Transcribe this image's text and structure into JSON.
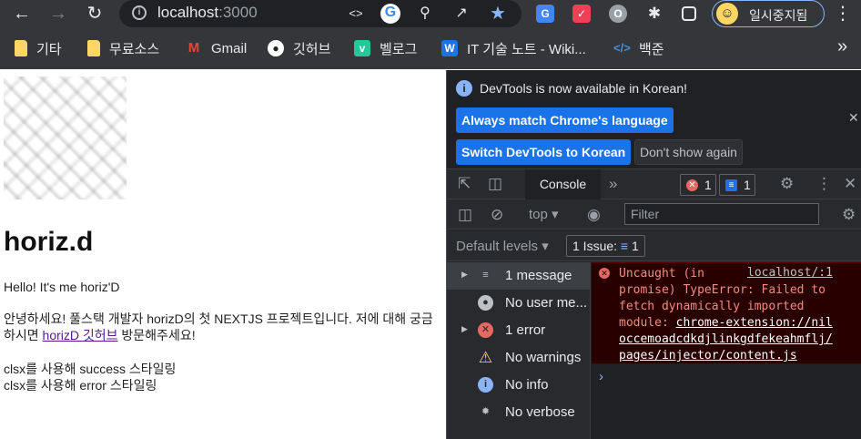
{
  "browser": {
    "url_host": "localhost",
    "url_port": ":3000",
    "profile_label": "일시중지됨"
  },
  "bookmarks": [
    {
      "label": "기타",
      "icon": "folder-icon"
    },
    {
      "label": "무료소스",
      "icon": "folder-icon"
    },
    {
      "label": "Gmail",
      "icon": "gmail-icon"
    },
    {
      "label": "깃허브",
      "icon": "github-icon"
    },
    {
      "label": "벨로그",
      "icon": "velog-icon"
    },
    {
      "label": "IT 기술 노트 - Wiki...",
      "icon": "wiki-icon"
    },
    {
      "label": "백준",
      "icon": "code-icon"
    }
  ],
  "page": {
    "title": "horiz.d",
    "greeting": "Hello! It's me horiz'D",
    "intro_before": "안녕하세요! 풀스택 개발자 horizD의 첫 NEXTJS 프로젝트입니다. 저에 대해 궁금하시면 ",
    "intro_link": "horizD 깃허브",
    "intro_after": " 방문해주세요!",
    "success_line": "clsx를 사용해 success 스타일링",
    "error_line": "clsx를 사용해 error 스타일링"
  },
  "devtools": {
    "notice": "DevTools is now available in Korean!",
    "btn_match": "Always match Chrome's language",
    "btn_switch": "Switch DevTools to Korean",
    "btn_dismiss": "Don't show again",
    "tab_console": "Console",
    "error_count": "1",
    "message_count": "1",
    "context": "top",
    "filter_placeholder": "Filter",
    "levels": "Default levels",
    "issues": "1 Issue:",
    "issues_count": "1",
    "sidebar": [
      {
        "label": "1 message",
        "icon": "list-icon"
      },
      {
        "label": "No user me...",
        "icon": "user-icon"
      },
      {
        "label": "1 error",
        "icon": "error-icon"
      },
      {
        "label": "No warnings",
        "icon": "warning-icon"
      },
      {
        "label": "No info",
        "icon": "info-icon"
      },
      {
        "label": "No verbose",
        "icon": "bug-icon"
      }
    ],
    "error": {
      "line1": "Uncaught (in",
      "source": "localhost/:1",
      "line2": "promise) TypeError: Failed to",
      "line3": "fetch dynamically imported",
      "line4_prefix": "module: ",
      "link1": "chrome-extension://nil",
      "link2": "occemoadcdkdjlinkgdfekeahmflj/",
      "link3": "pages/injector/content.js"
    }
  }
}
